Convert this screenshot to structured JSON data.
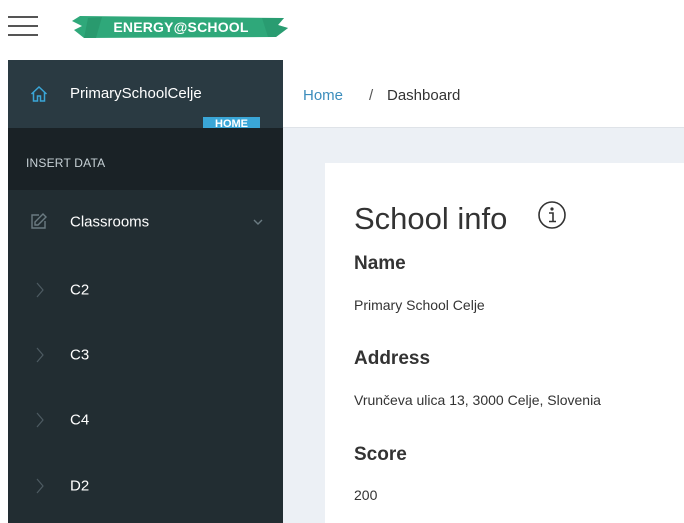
{
  "header": {
    "logo_text": "ENERGY@SCHOOL",
    "brand_color": "#2fa87a",
    "menu_icon": "hamburger-icon"
  },
  "sidebar": {
    "school_name": "PrimarySchoolCelje",
    "home_badge": "HOME",
    "section_header": "INSERT DATA",
    "items": [
      {
        "label": "Classrooms",
        "icon": "edit-icon",
        "expanded": true
      },
      {
        "label": "C2",
        "icon": "chevron-right-icon"
      },
      {
        "label": "C3",
        "icon": "chevron-right-icon"
      },
      {
        "label": "C4",
        "icon": "chevron-right-icon"
      },
      {
        "label": "D2",
        "icon": "chevron-right-icon"
      }
    ],
    "accent_color": "#3aa6d7"
  },
  "breadcrumb": {
    "home": "Home",
    "separator": "/",
    "current": "Dashboard"
  },
  "school_info": {
    "title": "School info",
    "name_label": "Name",
    "name_value": "Primary School Celje",
    "address_label": "Address",
    "address_value": "Vrunčeva ulica 13, 3000 Celje, Slovenia",
    "score_label": "Score",
    "score_value": "200"
  }
}
